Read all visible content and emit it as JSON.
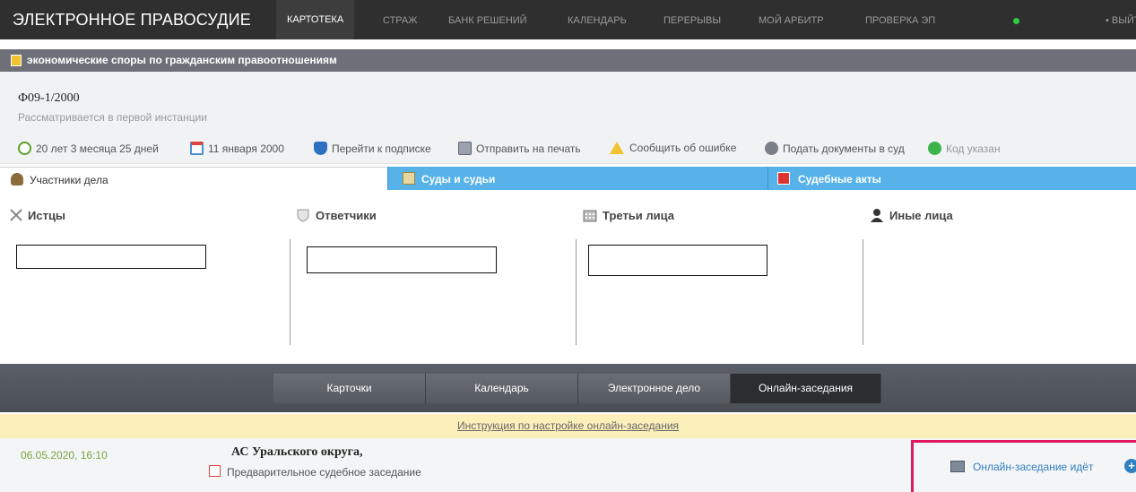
{
  "topnav": {
    "brand": "ЭЛЕКТРОННОЕ ПРАВОСУДИЕ",
    "items": [
      "КАРТОТЕКА",
      "СТРАЖ",
      "БАНК РЕШЕНИЙ",
      "КАЛЕНДАРЬ",
      "ПЕРЕРЫВЫ",
      "МОЙ АРБИТР",
      "ПРОВЕРКА ЭП"
    ],
    "active_item": "КАРТОТЕКА",
    "logout": "• ВЫЙТИ"
  },
  "category": {
    "label": "экономические споры по гражданским правоотношениям"
  },
  "case": {
    "number": "Ф09-1/2000",
    "status": "Рассматривается в первой инстанции",
    "actions": [
      {
        "label": "20 лет 3 месяца 25 дней",
        "icon": "clock-icon"
      },
      {
        "label": "11 января 2000",
        "icon": "calendar-icon"
      },
      {
        "label": "Перейти к подписке",
        "icon": "shield-icon"
      },
      {
        "label": "Отправить на печать",
        "icon": "printer-icon"
      },
      {
        "label": "Сообщить об ошибке",
        "icon": "warning-icon"
      },
      {
        "label": "Подать документы в суд",
        "icon": "plus-circle-icon"
      },
      {
        "label": "Код указан",
        "icon": "check-icon"
      }
    ]
  },
  "section_tabs": {
    "parties": "Участники дела",
    "courts": "Суды и судьи",
    "acts": "Судебные акты"
  },
  "parties": {
    "plaintiffs": "Истцы",
    "defendants": "Ответчики",
    "third_parties": "Третьи лица",
    "others": "Иные лица"
  },
  "bottom_tabs": [
    "Карточки",
    "Календарь",
    "Электронное дело",
    "Онлайн-заседания"
  ],
  "active_bottom_tab": "Онлайн-заседания",
  "instruction": "Инструкция по настройке онлайн-заседания",
  "hearing": {
    "datetime": "06.05.2020, 16:10",
    "court": "АС Уральского округа,",
    "type": "Предварительное судебное заседание",
    "online_status": "Онлайн-заседание идёт"
  },
  "colors": {
    "nav_bg": "#2f2f2f",
    "tab_blue": "#56b2e8",
    "highlight": "#e11760",
    "link": "#2f7fc1",
    "date_green": "#7ba23f"
  }
}
